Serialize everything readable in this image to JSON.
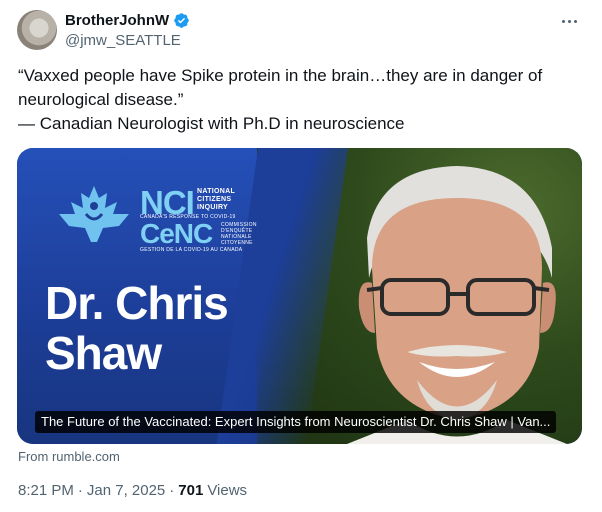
{
  "author": {
    "display_name": "BrotherJohnW",
    "handle": "@jmw_SEATTLE",
    "verified_color": "#1d9bf0"
  },
  "tweet": {
    "line1": "“Vaxxed people have Spike protein in the brain…they are in danger of",
    "line2": "neurological disease.”",
    "line3": "— Canadian Neurologist with Ph.D in neuroscience"
  },
  "card": {
    "org_acronym_1": "NCI",
    "org_line_1": "NATIONAL",
    "org_line_2": "CITIZENS",
    "org_line_3": "INQUIRY",
    "org_sub_1": "CANADA'S RESPONSE TO COVID-19",
    "org_acronym_2": "CeNC",
    "org_fr_1": "COMMISSION",
    "org_fr_2": "D'ENQUÊTE",
    "org_fr_3": "NATIONALE",
    "org_fr_4": "CITOYENNE",
    "org_sub_2": "GESTION DE LA COVID-19 AU CANADA",
    "headline_1": "Dr. Chris",
    "headline_2": "Shaw",
    "caption": "The Future of the Vaccinated: Expert Insights from Neuroscientist Dr. Chris Shaw | Van...",
    "source": "From rumble.com"
  },
  "meta": {
    "time": "8:21 PM",
    "separator": "·",
    "date": "Jan 7, 2025",
    "separator2": "·",
    "views_count": "701",
    "views_label": "Views"
  }
}
